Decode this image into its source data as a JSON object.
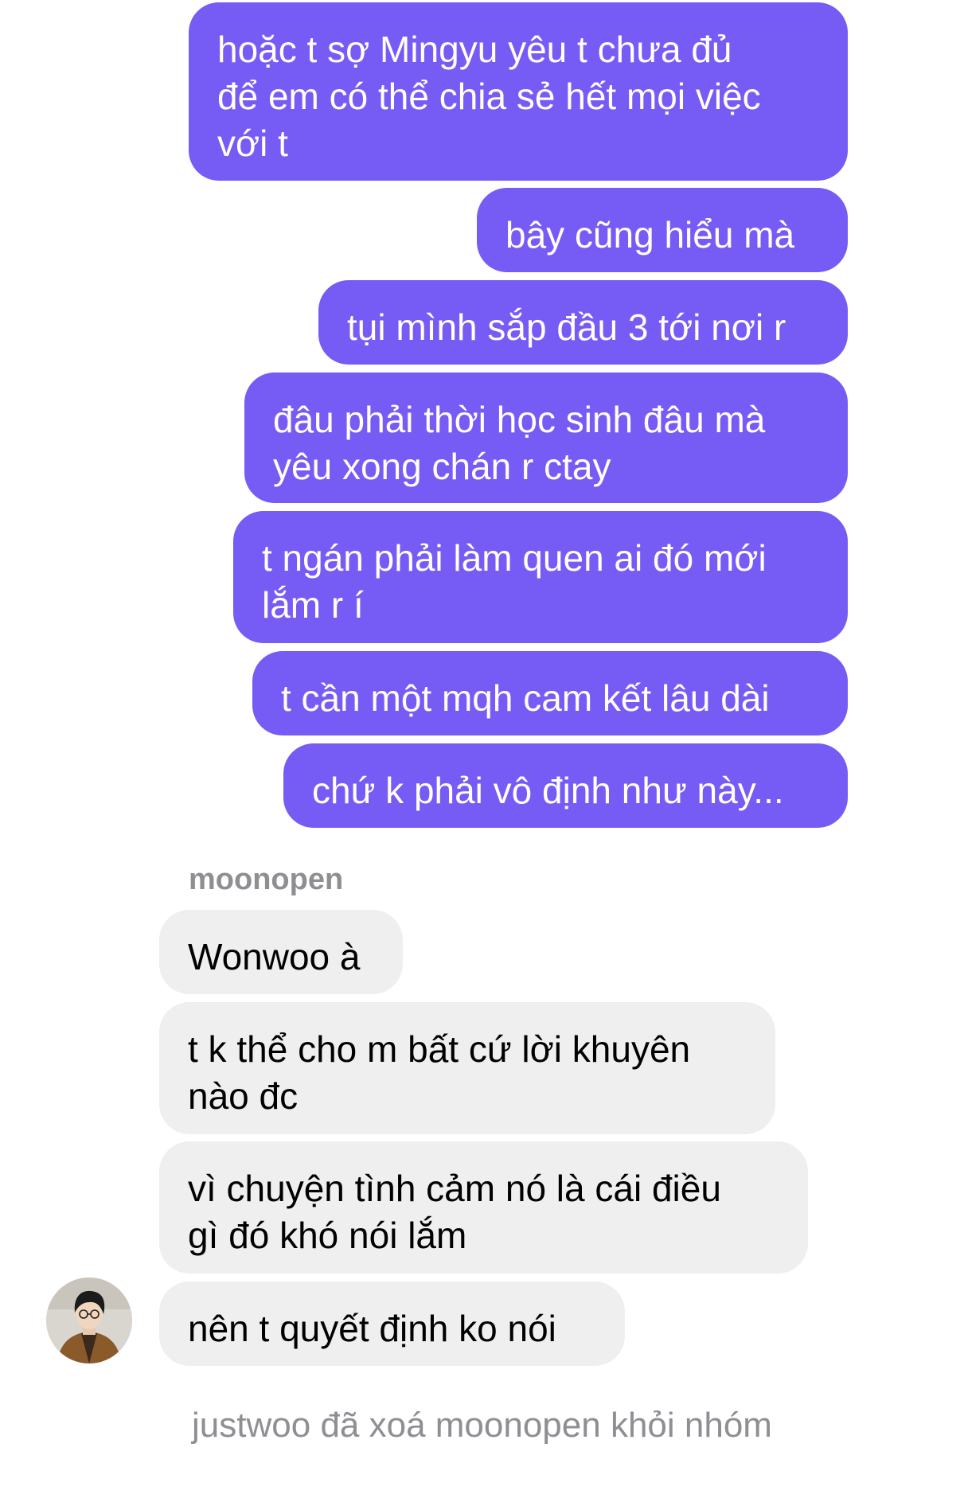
{
  "colors": {
    "outgoing_bubble": "#765BF4",
    "incoming_bubble": "#EFEFF0",
    "meta_text": "#8E8E93"
  },
  "outgoing_messages": [
    "hoặc t sợ Mingyu yêu t chưa đủ\nđể em có thể chia sẻ hết mọi việc\nvới t",
    "bây cũng hiểu mà",
    "tụi mình sắp đầu 3 tới nơi r",
    "đâu phải thời học sinh đâu mà\nyêu xong chán r ctay",
    "t ngán phải làm quen ai đó mới\nlắm r í",
    "t cần một mqh cam kết lâu dài",
    "chứ k phải vô định như này..."
  ],
  "incoming": {
    "sender": "moonopen",
    "avatar": "user-avatar-photo",
    "messages": [
      "Wonwoo à",
      "t k thể cho m bất cứ lời khuyên\nnào đc",
      "vì chuyện tình cảm nó là cái điều\ngì đó khó nói lắm",
      "nên t quyết định ko nói"
    ]
  },
  "system_message": "justwoo đã xoá moonopen khỏi nhóm"
}
